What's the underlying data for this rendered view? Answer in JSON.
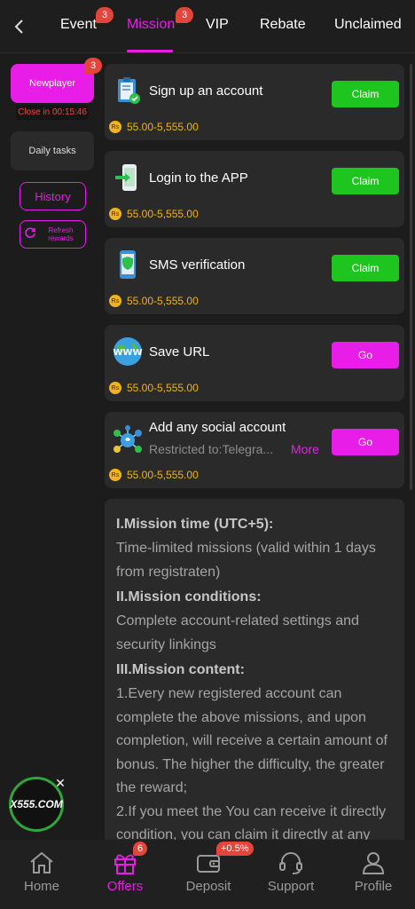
{
  "colors": {
    "accent": "#e81de8",
    "claim": "#1fc51f",
    "reward": "#f0b21d",
    "badge": "#e2453b"
  },
  "top_nav": {
    "tabs": [
      {
        "label": "Event",
        "badge": "3"
      },
      {
        "label": "Mission",
        "badge": "3",
        "active": true
      },
      {
        "label": "VIP"
      },
      {
        "label": "Rebate"
      },
      {
        "label": "Unclaimed"
      }
    ]
  },
  "sidebar": {
    "newplayer": {
      "label": "Newplayer",
      "badge": "3",
      "countdown": "Close in 00:15:46"
    },
    "daily": {
      "label": "Daily tasks"
    },
    "history_label": "History",
    "refresh_label": "Refresh rewards"
  },
  "currency_symbol": "Rs",
  "tasks": [
    {
      "name": "Sign up an account",
      "button": "Claim",
      "reward": "55.00-5,555.00",
      "icon": "clipboard-check-icon"
    },
    {
      "name": "Login to the APP",
      "button": "Claim",
      "reward": "55.00-5,555.00",
      "icon": "phone-login-icon"
    },
    {
      "name": "SMS verification",
      "button": "Claim",
      "reward": "55.00-5,555.00",
      "icon": "phone-shield-icon"
    },
    {
      "name": "Save URL",
      "button": "Go",
      "reward": "55.00-5,555.00",
      "icon": "www-globe-icon"
    },
    {
      "name": "Add any social account",
      "sub": "Restricted to:Telegra...",
      "more": "More",
      "button": "Go",
      "reward": "55.00-5,555.00",
      "icon": "social-network-icon"
    }
  ],
  "rules": [
    {
      "type": "h",
      "text": "I.Mission time (UTC+5):"
    },
    {
      "type": "p",
      "text": "Time-limited missions (valid within 1 days from registraten)"
    },
    {
      "type": "h",
      "text": "II.Mission conditions:"
    },
    {
      "type": "p",
      "text": "Complete account-related settings and security linkings"
    },
    {
      "type": "h",
      "text": "III.Mission content:"
    },
    {
      "type": "p",
      "text": "1.Every new registered account can complete the above missions, and upon completion, will receive a certain amount of bonus. The higher the difficulty, the greater the reward;"
    },
    {
      "type": "p",
      "text": "2.If you meet the You can receive it directly condition, you can claim it directly at any"
    }
  ],
  "floating_logo": {
    "text": "X555.COM"
  },
  "bottom_nav": {
    "items": [
      {
        "label": "Home",
        "icon": "home-icon"
      },
      {
        "label": "Offers",
        "icon": "gift-icon",
        "badge": "6",
        "active": true
      },
      {
        "label": "Deposit",
        "icon": "wallet-icon",
        "badge": "+0.5%"
      },
      {
        "label": "Support",
        "icon": "headset-icon"
      },
      {
        "label": "Profile",
        "icon": "person-icon"
      }
    ]
  }
}
